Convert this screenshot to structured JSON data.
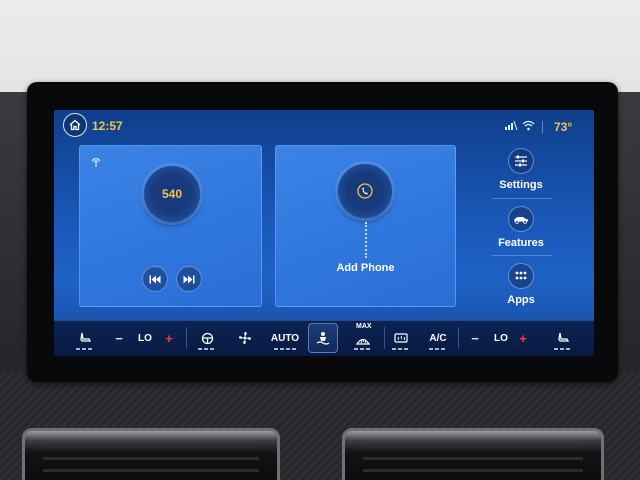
{
  "status": {
    "time": "12:57",
    "temperature": "73°"
  },
  "radio": {
    "station": "540"
  },
  "phone": {
    "label": "Add Phone"
  },
  "menu": {
    "settings": "Settings",
    "features": "Features",
    "apps": "Apps"
  },
  "climate": {
    "minus": "−",
    "plus": "+",
    "left_temp": "LO",
    "right_temp": "LO",
    "fan_mode": "AUTO",
    "max_label": "MAX",
    "ac": "A/C"
  },
  "colors": {
    "accent_yellow": "#f4c542",
    "screen_blue": "#1f62c5",
    "card_blue": "#2f76dc",
    "climate_bar": "#0b2456",
    "plus_red": "#ff3b3b"
  },
  "icons": {
    "home": "home-icon",
    "signal": "signal-icon",
    "wifi": "wifi-icon",
    "radio_signal": "radio-signal-icon",
    "prev": "skip-previous-icon",
    "next": "skip-next-icon",
    "phone": "phone-icon",
    "settings": "sliders-icon",
    "features": "car-icon",
    "apps": "grid-icon",
    "seat_heat": "heated-seat-icon",
    "steering": "heated-steering-icon",
    "fan": "fan-icon",
    "climate_center": "climate-icon",
    "front_defrost": "front-defrost-icon",
    "rear_defrost": "rear-defrost-icon"
  }
}
